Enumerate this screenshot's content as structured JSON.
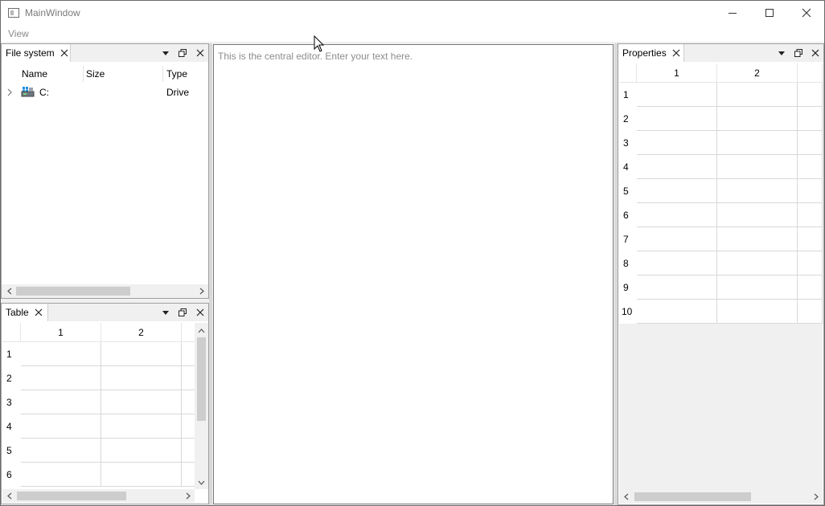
{
  "window": {
    "title": "MainWindow"
  },
  "menu": {
    "items": [
      "View"
    ]
  },
  "file_system": {
    "tab_label": "File system",
    "columns": [
      "Name",
      "Size",
      "Type"
    ],
    "rows": [
      {
        "name": "C:",
        "size": "",
        "type": "Drive"
      }
    ]
  },
  "table_dock": {
    "tab_label": "Table",
    "column_headers": [
      "1",
      "2"
    ],
    "row_headers": [
      "1",
      "2",
      "3",
      "4",
      "5",
      "6"
    ]
  },
  "editor": {
    "placeholder": "This is the central editor. Enter your text here."
  },
  "properties": {
    "tab_label": "Properties",
    "column_headers": [
      "1",
      "2"
    ],
    "row_headers": [
      "1",
      "2",
      "3",
      "4",
      "5",
      "6",
      "7",
      "8",
      "9",
      "10"
    ]
  },
  "icons": {
    "dock_menu": "triangle-down-icon",
    "dock_float": "float-icon",
    "dock_close": "close-icon",
    "tree_expand": "chevron-right-icon",
    "drive": "drive-icon"
  },
  "colors": {
    "border": "#a0a0a0",
    "background": "#f0f0f0",
    "grid_line": "#d8d8d8",
    "placeholder_text": "#8c8c8c"
  }
}
